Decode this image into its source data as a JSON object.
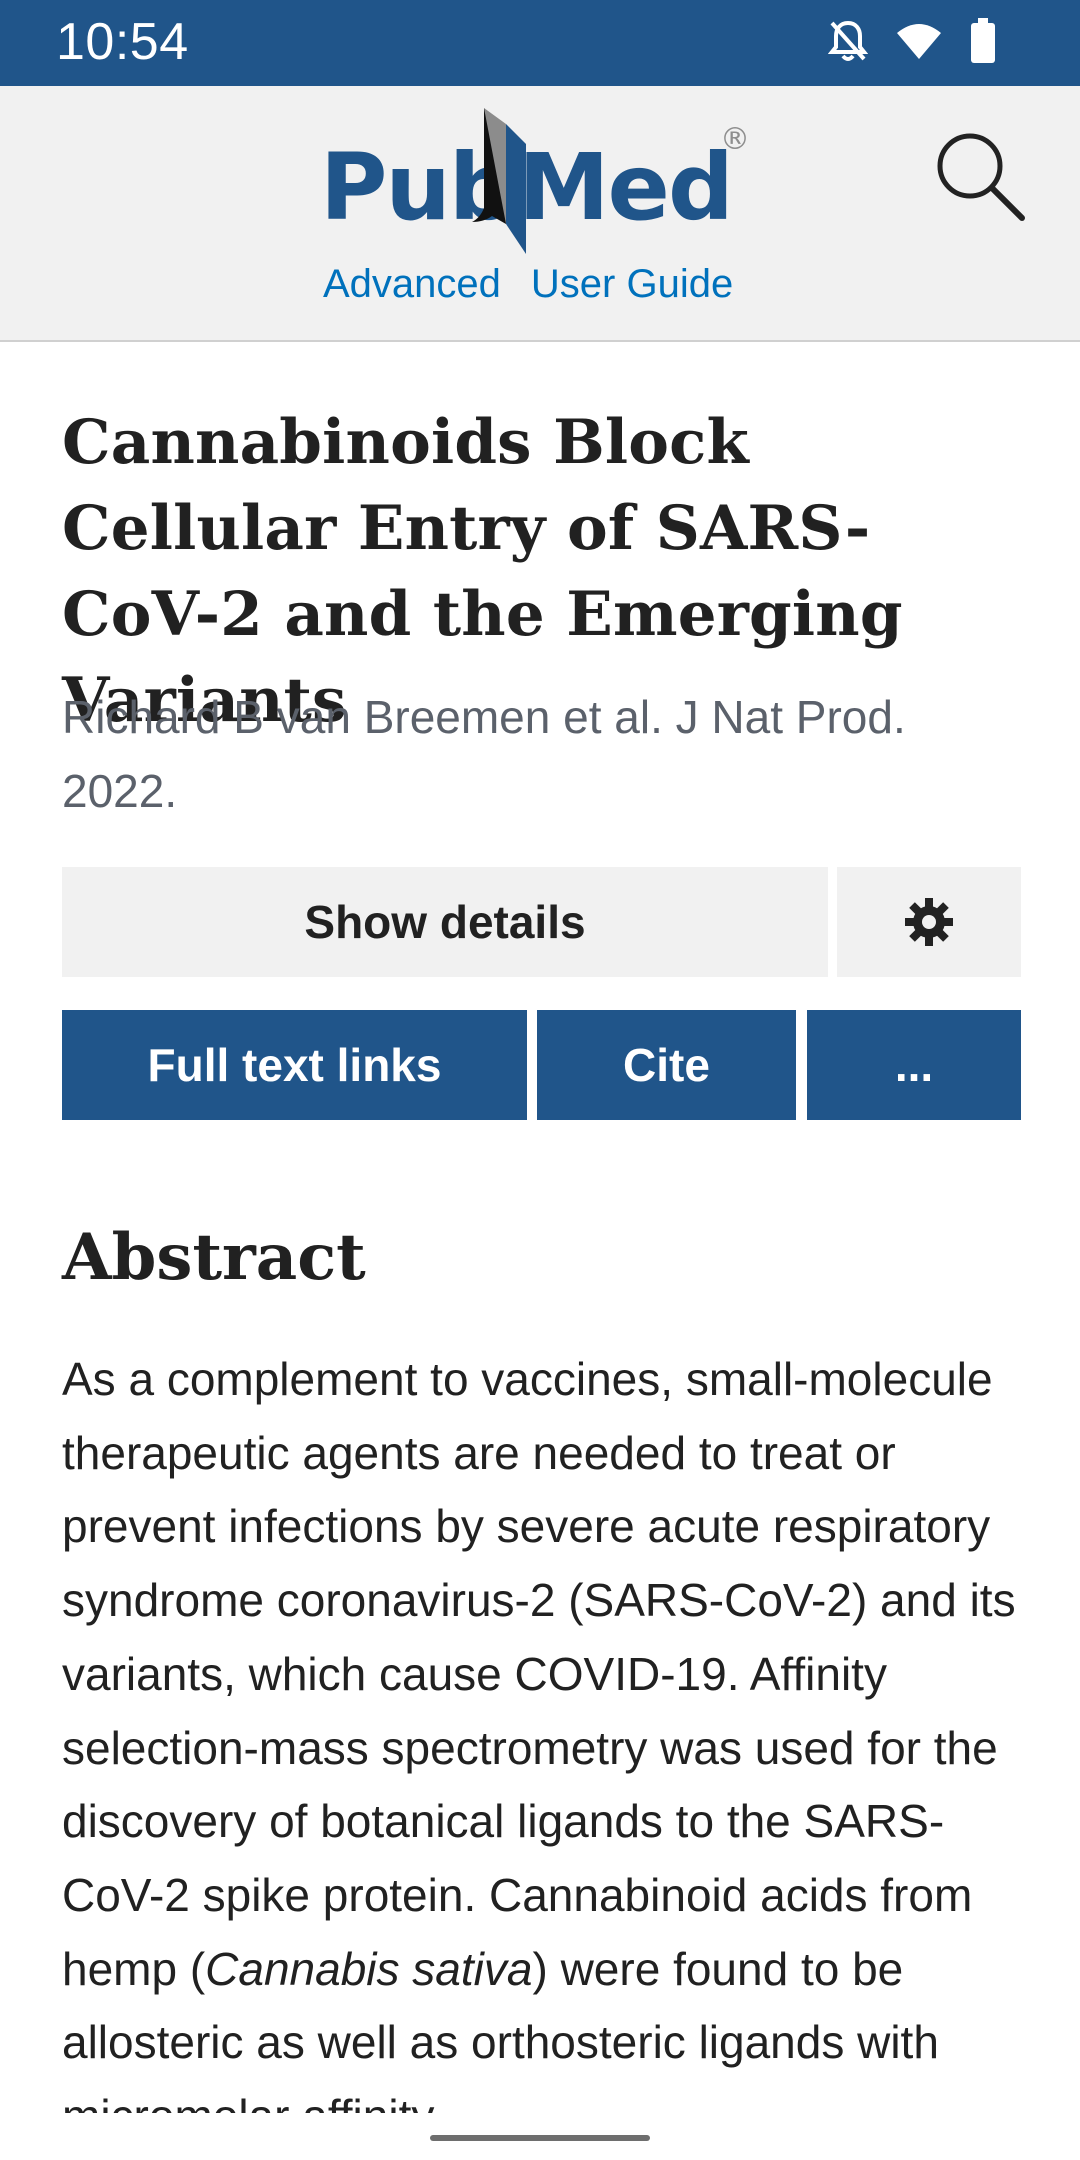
{
  "status_bar": {
    "time": "10:54",
    "icons": [
      "notifications-off-icon",
      "wifi-icon",
      "battery-icon"
    ]
  },
  "header": {
    "logo_pub": "Pub",
    "logo_med": "Med",
    "logo_reg": "®",
    "links": [
      "Advanced",
      "User Guide"
    ]
  },
  "article": {
    "title": "Cannabinoids Block Cellular Entry of SARS-CoV-2 and the Emerging Variants",
    "citation": "Richard B van Breemen et al. J Nat Prod. 2022."
  },
  "actions": {
    "show_details": "Show details",
    "full_text_links": "Full text links",
    "cite": "Cite",
    "more": "..."
  },
  "abstract": {
    "heading": "Abstract",
    "text_before_italic": "As a complement to vaccines, small-molecule therapeutic agents are needed to treat or prevent infections by severe acute respiratory syndrome coronavirus-2 (SARS-CoV-2) and its variants, which cause COVID-19. Affinity selection-mass spectrometry was used for the discovery of botanical ligands to the SARS-CoV-2 spike protein. Cannabinoid acids from hemp (",
    "italic": "Cannabis sativa",
    "text_after_italic": ") were found to be allosteric as well as orthosteric ligands with micromolar affinity"
  },
  "colors": {
    "brand_blue": "#20558a",
    "link_blue": "#0071bc",
    "header_bg": "#f1f1f1"
  }
}
